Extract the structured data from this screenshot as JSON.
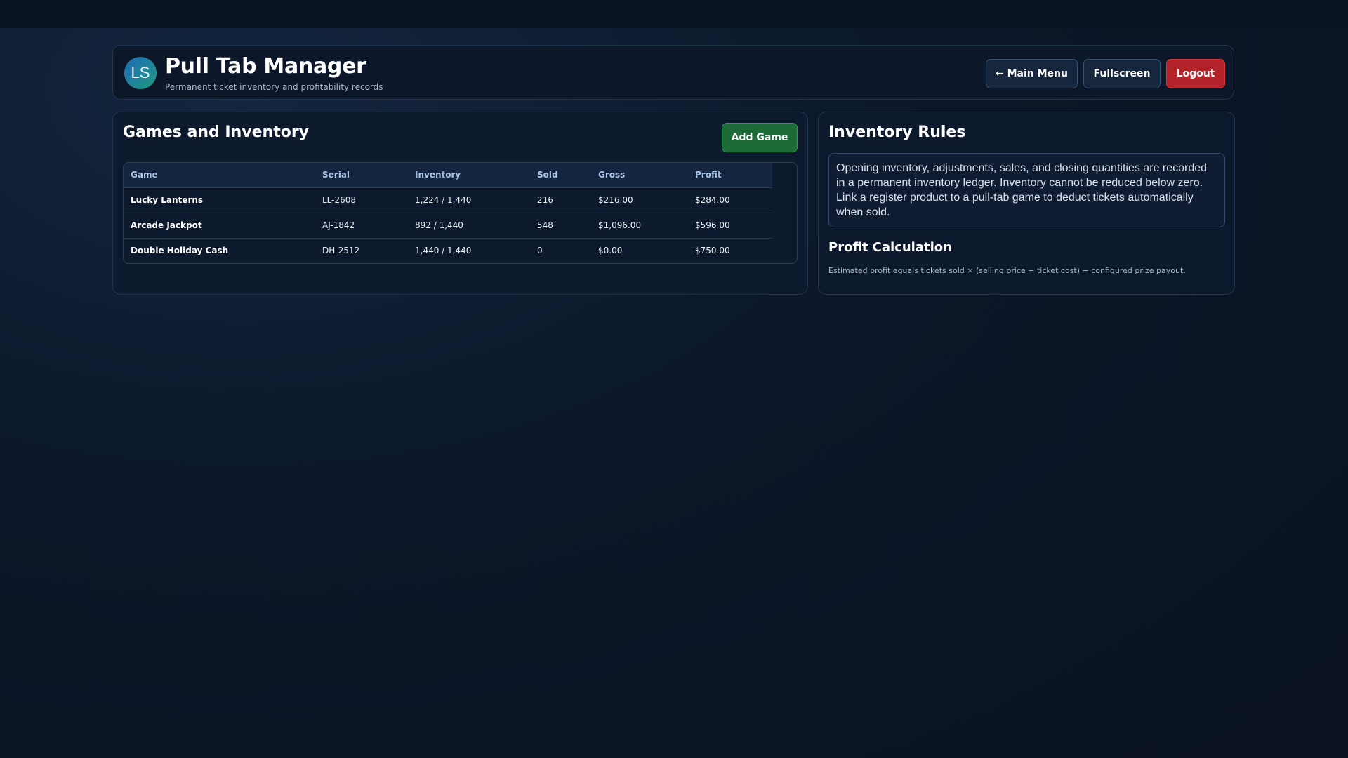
{
  "header": {
    "avatar_initials": "LS",
    "title": "Pull Tab Manager",
    "subtitle": "Permanent ticket inventory and profitability records",
    "main_menu_label": "← Main Menu",
    "fullscreen_label": "Fullscreen",
    "logout_label": "Logout"
  },
  "games": {
    "title": "Games and Inventory",
    "add_label": "Add Game",
    "columns": [
      "Game",
      "Serial",
      "Inventory",
      "Sold",
      "Gross",
      "Profit"
    ],
    "rows": [
      {
        "game": "Lucky Lanterns",
        "serial": "LL-2608",
        "inventory": "1,224 / 1,440",
        "sold": "216",
        "gross": "$216.00",
        "profit": "$284.00"
      },
      {
        "game": "Arcade Jackpot",
        "serial": "AJ-1842",
        "inventory": "892 / 1,440",
        "sold": "548",
        "gross": "$1,096.00",
        "profit": "$596.00"
      },
      {
        "game": "Double Holiday Cash",
        "serial": "DH-2512",
        "inventory": "1,440 / 1,440",
        "sold": "0",
        "gross": "$0.00",
        "profit": "$750.00"
      }
    ]
  },
  "rules": {
    "title": "Inventory Rules",
    "text": "Opening inventory, adjustments, sales, and closing quantities are recorded in a permanent inventory ledger. Inventory cannot be reduced below zero. Link a register product to a pull-tab game to deduct tickets automatically when sold.",
    "profit_title": "Profit Calculation",
    "profit_text": "Estimated profit equals tickets sold × (selling price − ticket cost) − configured prize payout."
  },
  "colors": {
    "background": "#0b1628",
    "panel": "#0d192c",
    "add_button": "#1d6b37",
    "logout_button": "#b3242a",
    "header_text": "#a8c4e6"
  }
}
